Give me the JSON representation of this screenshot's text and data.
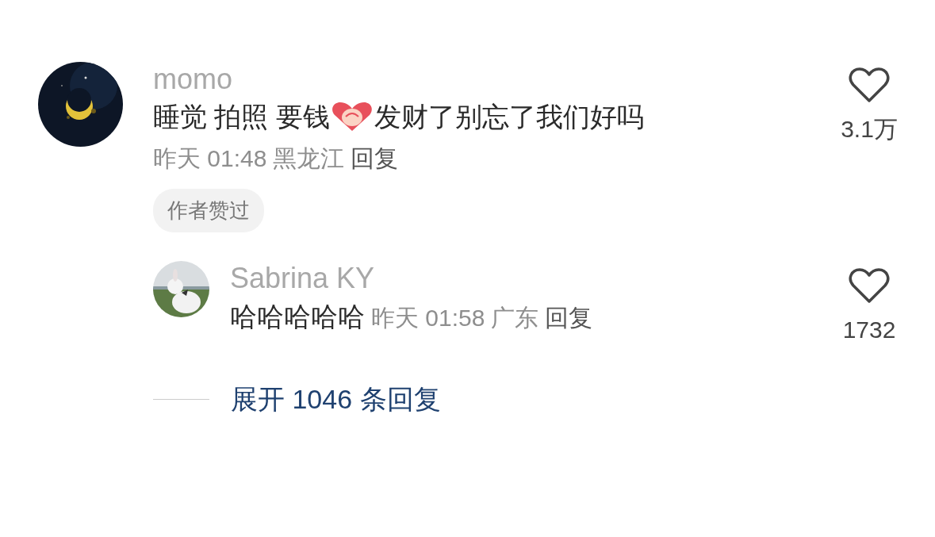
{
  "comment": {
    "author": "momo",
    "text_parts": [
      "睡觉 拍照 要钱",
      "发财了别忘了我们好吗"
    ],
    "time": "昨天 01:48",
    "location": "黑龙江",
    "reply_label": "回复",
    "tag": "作者赞过",
    "likes": "3.1万",
    "liked": false,
    "replies": [
      {
        "author": "Sabrina KY",
        "text": "哈哈哈哈哈",
        "time": "昨天 01:58",
        "location": "广东",
        "reply_label": "回复",
        "likes": "1732",
        "liked": false
      }
    ],
    "expand_label": "展开 1046 条回复"
  }
}
